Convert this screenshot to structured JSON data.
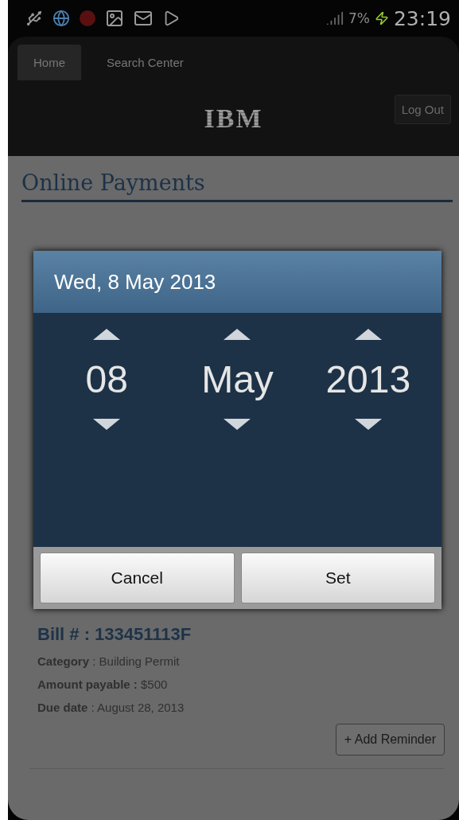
{
  "status_bar": {
    "battery": "7%",
    "time": "23:19"
  },
  "nav": {
    "tabs": [
      {
        "label": "Home",
        "selected": true
      },
      {
        "label": "Search Center",
        "selected": false
      }
    ],
    "logo": "IBM",
    "logout": "Log Out"
  },
  "page": {
    "title": "Online Payments"
  },
  "bill": {
    "number": "Bill # : 133451113F",
    "fields": [
      "**Category** : Building Permit",
      "**Amount payable :** $500",
      "**Due date** : August 28, 2013"
    ],
    "button": "+ Add Reminder"
  },
  "date_dialog": {
    "title": "Wed, 8 May 2013",
    "columns": [
      {
        "value": "08"
      },
      {
        "value": "May"
      },
      {
        "value": "2013"
      }
    ],
    "buttons": [
      "Cancel",
      "Set"
    ]
  }
}
